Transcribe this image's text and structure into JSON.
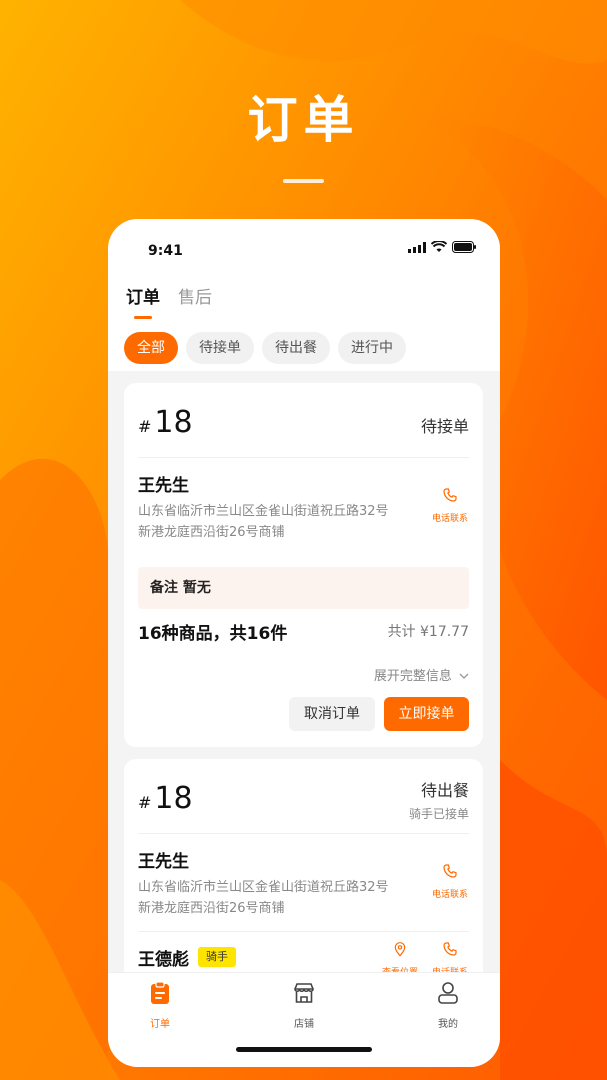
{
  "headline": "订单",
  "status_bar": {
    "time": "9:41"
  },
  "tabs": [
    {
      "label": "订单",
      "active": true
    },
    {
      "label": "售后",
      "active": false
    }
  ],
  "filters": [
    {
      "label": "全部",
      "active": true
    },
    {
      "label": "待接单",
      "active": false
    },
    {
      "label": "待出餐",
      "active": false
    },
    {
      "label": "进行中",
      "active": false
    }
  ],
  "orders": [
    {
      "hash": "#",
      "number": "18",
      "status": "待接单",
      "customer_name": "王先生",
      "address": "山东省临沂市兰山区金雀山街道祝丘路32号新港龙庭西沿街26号商铺",
      "call_label": "电话联系",
      "remark": "备注 暂无",
      "goods_summary": "16种商品，共16件",
      "total": "共计 ¥17.77",
      "expand_label": "展开完整信息",
      "cancel_label": "取消订单",
      "accept_label": "立即接单"
    },
    {
      "hash": "#",
      "number": "18",
      "status": "待出餐",
      "sub_status": "骑手已接单",
      "customer_name": "王先生",
      "address": "山东省临沂市兰山区金雀山街道祝丘路32号新港龙庭西沿街26号商铺",
      "call_label": "电话联系",
      "rider_name": "王德彪",
      "rider_tag": "骑手",
      "location_label": "查看位置",
      "rider_call_label": "电话联系"
    }
  ],
  "tabbar": [
    {
      "label": "订单",
      "icon": "clipboard-icon",
      "active": true
    },
    {
      "label": "店铺",
      "icon": "store-icon",
      "active": false
    },
    {
      "label": "我的",
      "icon": "user-icon",
      "active": false
    }
  ],
  "colors": {
    "accent": "#ff6a00",
    "rider_tag": "#ffe400",
    "remark_bg": "#fdf3ee"
  }
}
